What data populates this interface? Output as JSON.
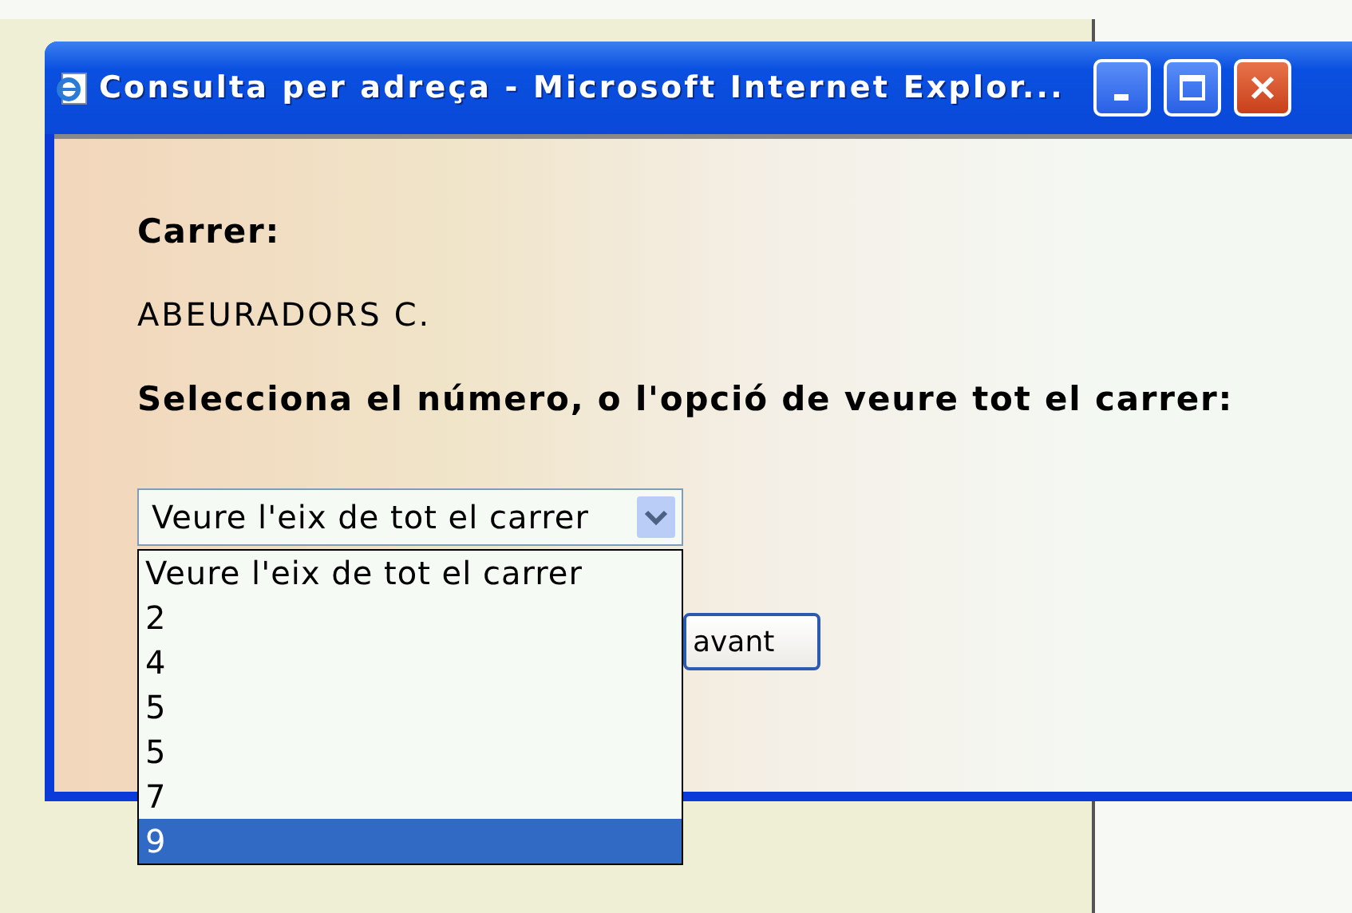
{
  "window": {
    "title": "Consulta per adreça - Microsoft Internet Explor..."
  },
  "street_label": "Carrer:",
  "street": "ABEURADORS C.",
  "prompt": "Selecciona el número, o l'opció de veure tot el carrer:",
  "select": {
    "value": "Veure l'eix de tot el carrer",
    "expanded": true
  },
  "options": [
    {
      "label": "Veure l'eix de tot el carrer",
      "selected": false
    },
    {
      "label": "2",
      "selected": false
    },
    {
      "label": "4",
      "selected": false
    },
    {
      "label": "5",
      "selected": false
    },
    {
      "label": "5",
      "selected": false
    },
    {
      "label": "7",
      "selected": false
    },
    {
      "label": "9",
      "selected": true
    }
  ],
  "button": {
    "label": "avant"
  }
}
